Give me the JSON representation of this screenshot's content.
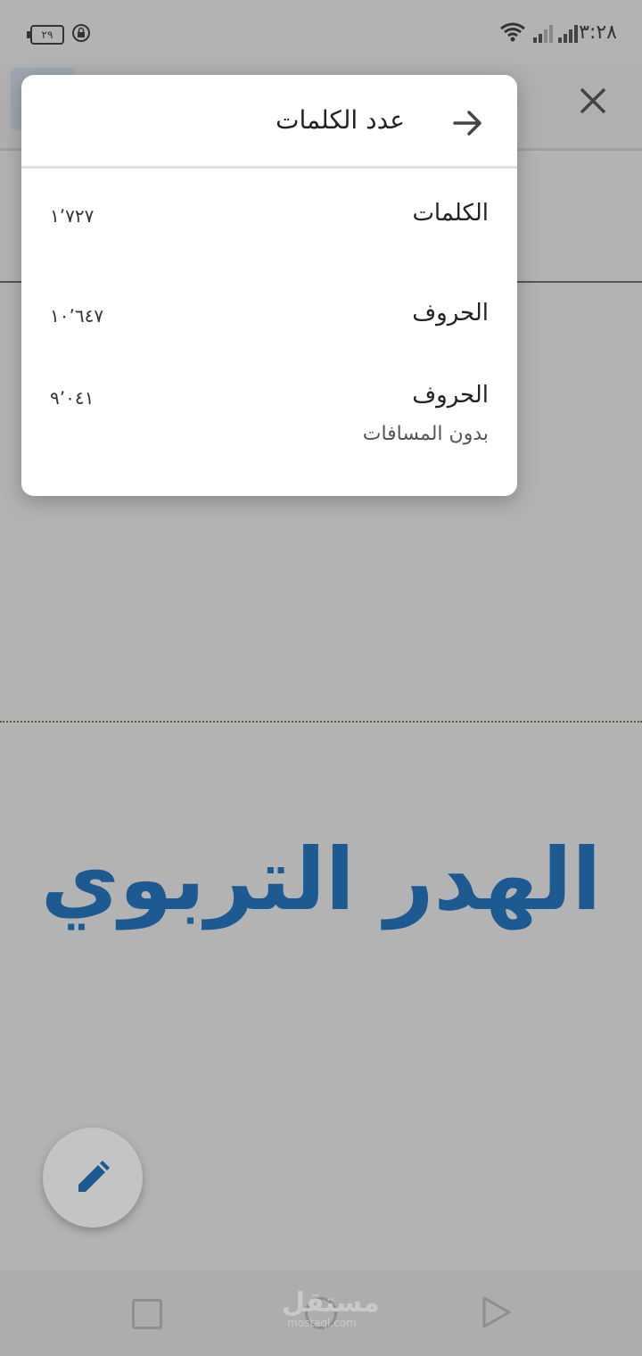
{
  "status_bar": {
    "time": "٣:٢٨",
    "battery": "٢٩"
  },
  "document": {
    "heading": "الهدر التربوي"
  },
  "dialog": {
    "title": "عدد الكلمات",
    "rows": [
      {
        "label": "الكلمات",
        "value": "١٬٧٢٧"
      },
      {
        "label": "الحروف",
        "value": "١٠٬٦٤٧"
      },
      {
        "label": "الحروف",
        "sublabel": "بدون المسافات",
        "value": "٩٬٠٤١"
      }
    ]
  },
  "nav": {
    "watermark": "مستقل",
    "watermark_sub": "mostaql.com"
  },
  "colors": {
    "heading": "#1d5a92",
    "fab_icon": "#1d5a92",
    "scrim": "#b3b3b3"
  }
}
